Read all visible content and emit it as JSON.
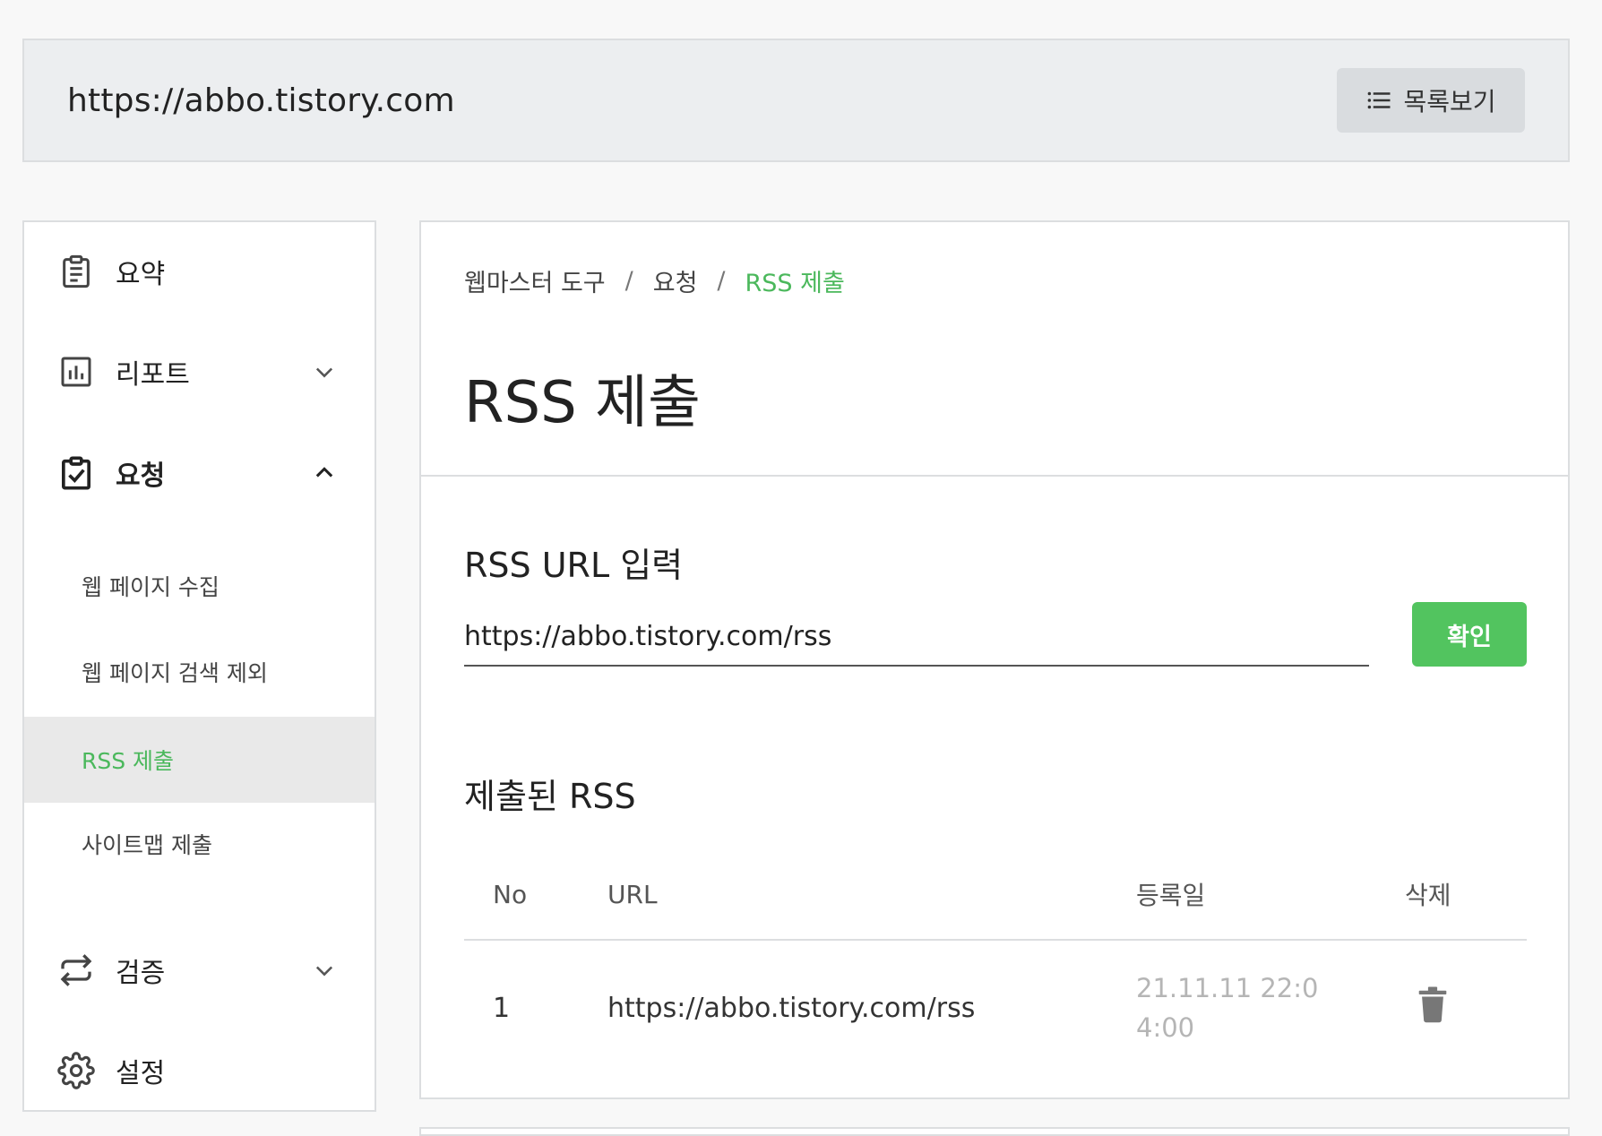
{
  "header": {
    "site_url": "https://abbo.tistory.com",
    "list_button_label": "목록보기"
  },
  "sidebar": {
    "summary": "요약",
    "report": "리포트",
    "request": "요청",
    "request_items": [
      "웹 페이지 수집",
      "웹 페이지 검색 제외",
      "RSS 제출",
      "사이트맵 제출"
    ],
    "verify": "검증",
    "settings": "설정"
  },
  "breadcrumb": {
    "root": "웹마스터 도구",
    "parent": "요청",
    "current": "RSS 제출",
    "separator": "/"
  },
  "page": {
    "title": "RSS 제출",
    "input_section_title": "RSS URL 입력",
    "input_value": "https://abbo.tistory.com/rss",
    "confirm_label": "확인",
    "submitted_title": "제출된 RSS"
  },
  "table": {
    "headers": [
      "No",
      "URL",
      "등록일",
      "삭제"
    ],
    "rows": [
      {
        "no": "1",
        "url": "https://abbo.tistory.com/rss",
        "date": "21.11.11 22:04:00"
      }
    ]
  },
  "colors": {
    "accent": "#4bb85c",
    "confirm": "#52c45f"
  }
}
